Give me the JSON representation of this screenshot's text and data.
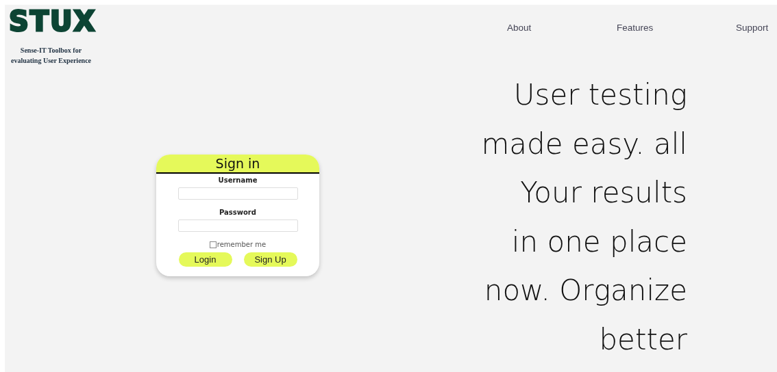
{
  "logo": {
    "text": "STUX",
    "tagline": "Sense-IT Toolbox for evaluating User Experience"
  },
  "nav": [
    {
      "label": "About"
    },
    {
      "label": "Features"
    },
    {
      "label": "Support"
    }
  ],
  "signin": {
    "title": "Sign in",
    "fields": [
      {
        "label": "Username"
      },
      {
        "label": "Password"
      }
    ],
    "remember": {
      "label": "remember me",
      "checked": false
    },
    "buttons": [
      "Login",
      "Sign Up"
    ]
  },
  "hero": [
    "User testing",
    "made easy. all",
    "Your results",
    "in one place",
    "now. Organize",
    "better"
  ]
}
